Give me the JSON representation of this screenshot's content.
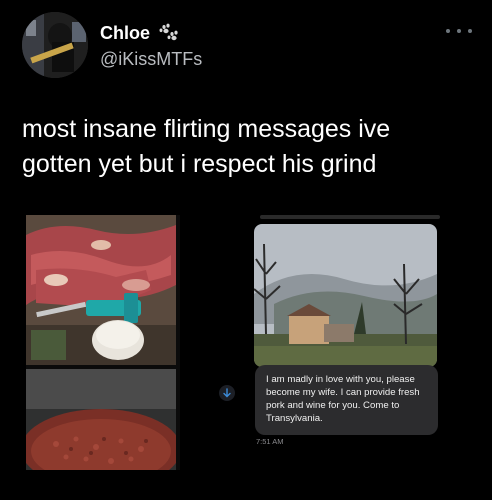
{
  "tweet": {
    "display_name": "Chloe",
    "name_emoji_icon": "paw-prints-icon",
    "handle": "@iKissMTFs",
    "text": "most insane flirting messages ive\ngotten yet but i respect his grind",
    "more_icon": "more-options-icon"
  },
  "media": {
    "images": [
      "meat-on-table-photo",
      "ground-meat-photo",
      "transylvania-landscape-photo"
    ],
    "chat": {
      "message": "I am madly in love with you, please become my wife. I can provide fresh pork and wine for you. Come to Transylvania.",
      "time": "7:51 AM",
      "scroll_icon": "arrow-down-icon"
    }
  },
  "colors": {
    "background": "#000000",
    "handle": "#b9bcc0",
    "bubble": "#2c2c2e"
  }
}
